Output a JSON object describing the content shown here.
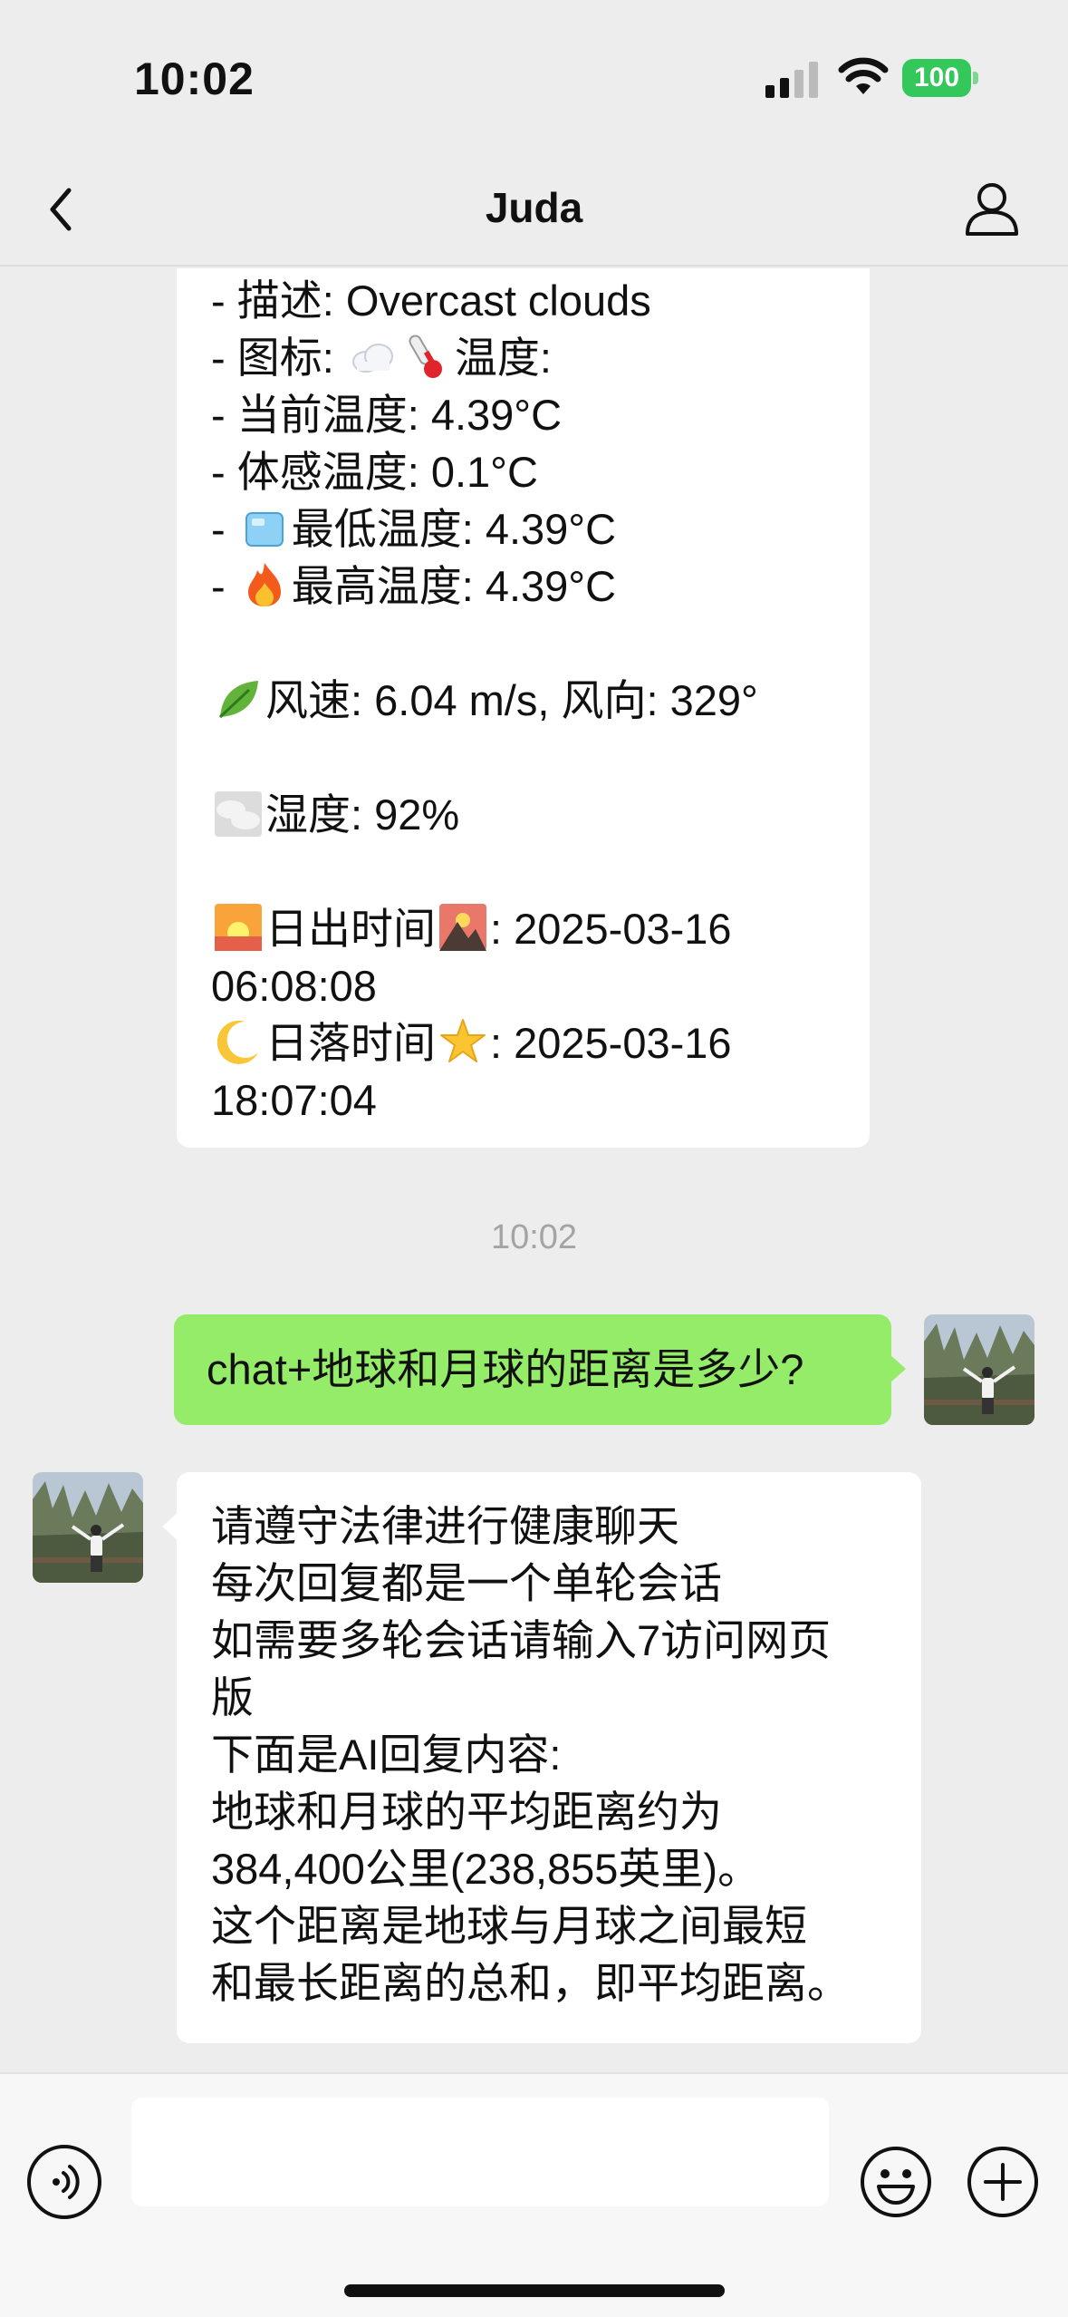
{
  "status_bar": {
    "time": "10:02",
    "battery": "100"
  },
  "nav": {
    "title": "Juda"
  },
  "weather_message": {
    "lines": [
      "- 描述: Overcast clouds",
      "- 图标: ",
      "温度:",
      "- 当前温度: 4.39°C",
      "- 体感温度: 0.1°C",
      "- ",
      "最低温度: 4.39°C",
      "- ",
      "最高温度: 4.39°C",
      "风速: 6.04 m/s, 风向: 329°",
      "湿度: 92%",
      "日出时间",
      ": 2025-03-16",
      "06:08:08",
      "日落时间",
      ": 2025-03-16",
      "18:07:04"
    ]
  },
  "timestamp": "10:02",
  "outgoing": {
    "text": "chat+地球和月球的距离是多少?"
  },
  "reply": {
    "lines": [
      "请遵守法律进行健康聊天",
      "每次回复都是一个单轮会话",
      "如需要多轮会话请输入7访问网页",
      "版",
      "下面是AI回复内容:",
      "地球和月球的平均距离约为",
      "384,400公里(238,855英里)。",
      "这个距离是地球与月球之间最短",
      "和最长距离的总和，即平均距离。"
    ]
  },
  "icons": [
    "cloud-icon",
    "thermometer-icon",
    "ice-cube-icon",
    "fire-icon",
    "leaf-icon",
    "fog-icon",
    "sunrise-icon",
    "mountain-sunrise-icon",
    "crescent-moon-icon",
    "star-icon"
  ],
  "colors": {
    "outgoing_bubble": "#95ec69",
    "background": "#ededed",
    "battery": "#34c759"
  }
}
